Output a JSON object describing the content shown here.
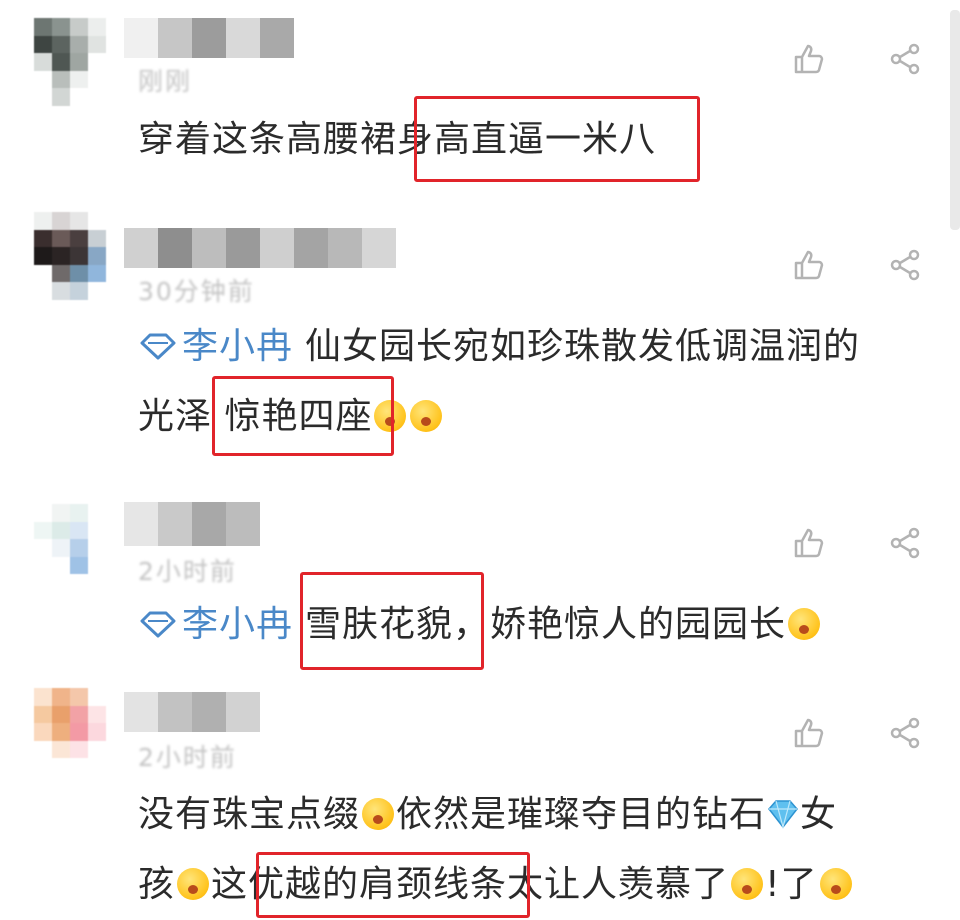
{
  "comments": [
    {
      "time": "刚刚",
      "text": "穿着这条高腰裙身高直逼一米八",
      "highlight": "身高直逼一米八"
    },
    {
      "time": "30分钟前",
      "mention": "李小冉",
      "text_line1": "仙女园长宛如珍珠散发低调温润的",
      "text_line2_pre": "光泽",
      "highlight": "惊艳四座"
    },
    {
      "time": "2小时前",
      "mention": "李小冉",
      "highlight": "雪肤花貌",
      "text_post": "，娇艳惊人的园园长"
    },
    {
      "time": "2小时前",
      "text_line1_a": "没有珠宝点缀",
      "text_line1_b": "依然是璀璨夺目的钻石",
      "text_line1_c": "女",
      "text_line2_a": "孩",
      "text_line2_b": "这",
      "highlight": "优越的肩颈线条",
      "text_line2_c": "太让人羡慕了",
      "text_line2_d": "!了"
    }
  ],
  "icons": [
    "like-icon",
    "share-icon",
    "diamond-icon",
    "emoji-icon",
    "gem-icon"
  ],
  "colors": {
    "highlight": "#e1242a",
    "mention": "#4a88c8",
    "text": "#2b2b2b",
    "time": "#c2c2c2"
  }
}
